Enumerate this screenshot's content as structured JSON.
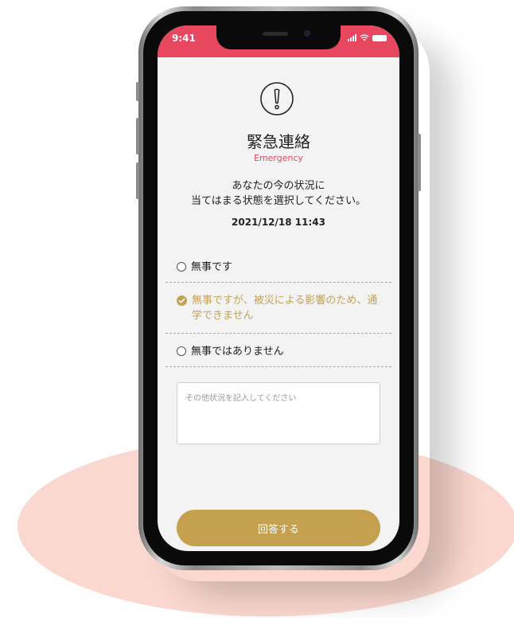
{
  "status_bar": {
    "time": "9:41"
  },
  "header": {
    "icon": "exclamation-circle-icon",
    "title": "緊急連絡",
    "subtitle": "Emergency"
  },
  "instruction": {
    "line1": "あなたの今の状況に",
    "line2": "当てはまる状態を選択してください。"
  },
  "datetime": "2021/12/18 11:43",
  "options": [
    {
      "label": "無事です",
      "selected": false
    },
    {
      "label": "無事ですが、被災による影響のため、通学できません",
      "selected": true
    },
    {
      "label": "無事ではありません",
      "selected": false
    }
  ],
  "other_input": {
    "placeholder": "その他状況を記入してください",
    "value": ""
  },
  "submit": {
    "label": "回答する"
  },
  "colors": {
    "status_bar": "#e8485f",
    "accent_pink": "#e14a62",
    "gold": "#c4a04f",
    "screen_bg": "#f3f3f3",
    "backdrop": "#fbd8cf"
  }
}
